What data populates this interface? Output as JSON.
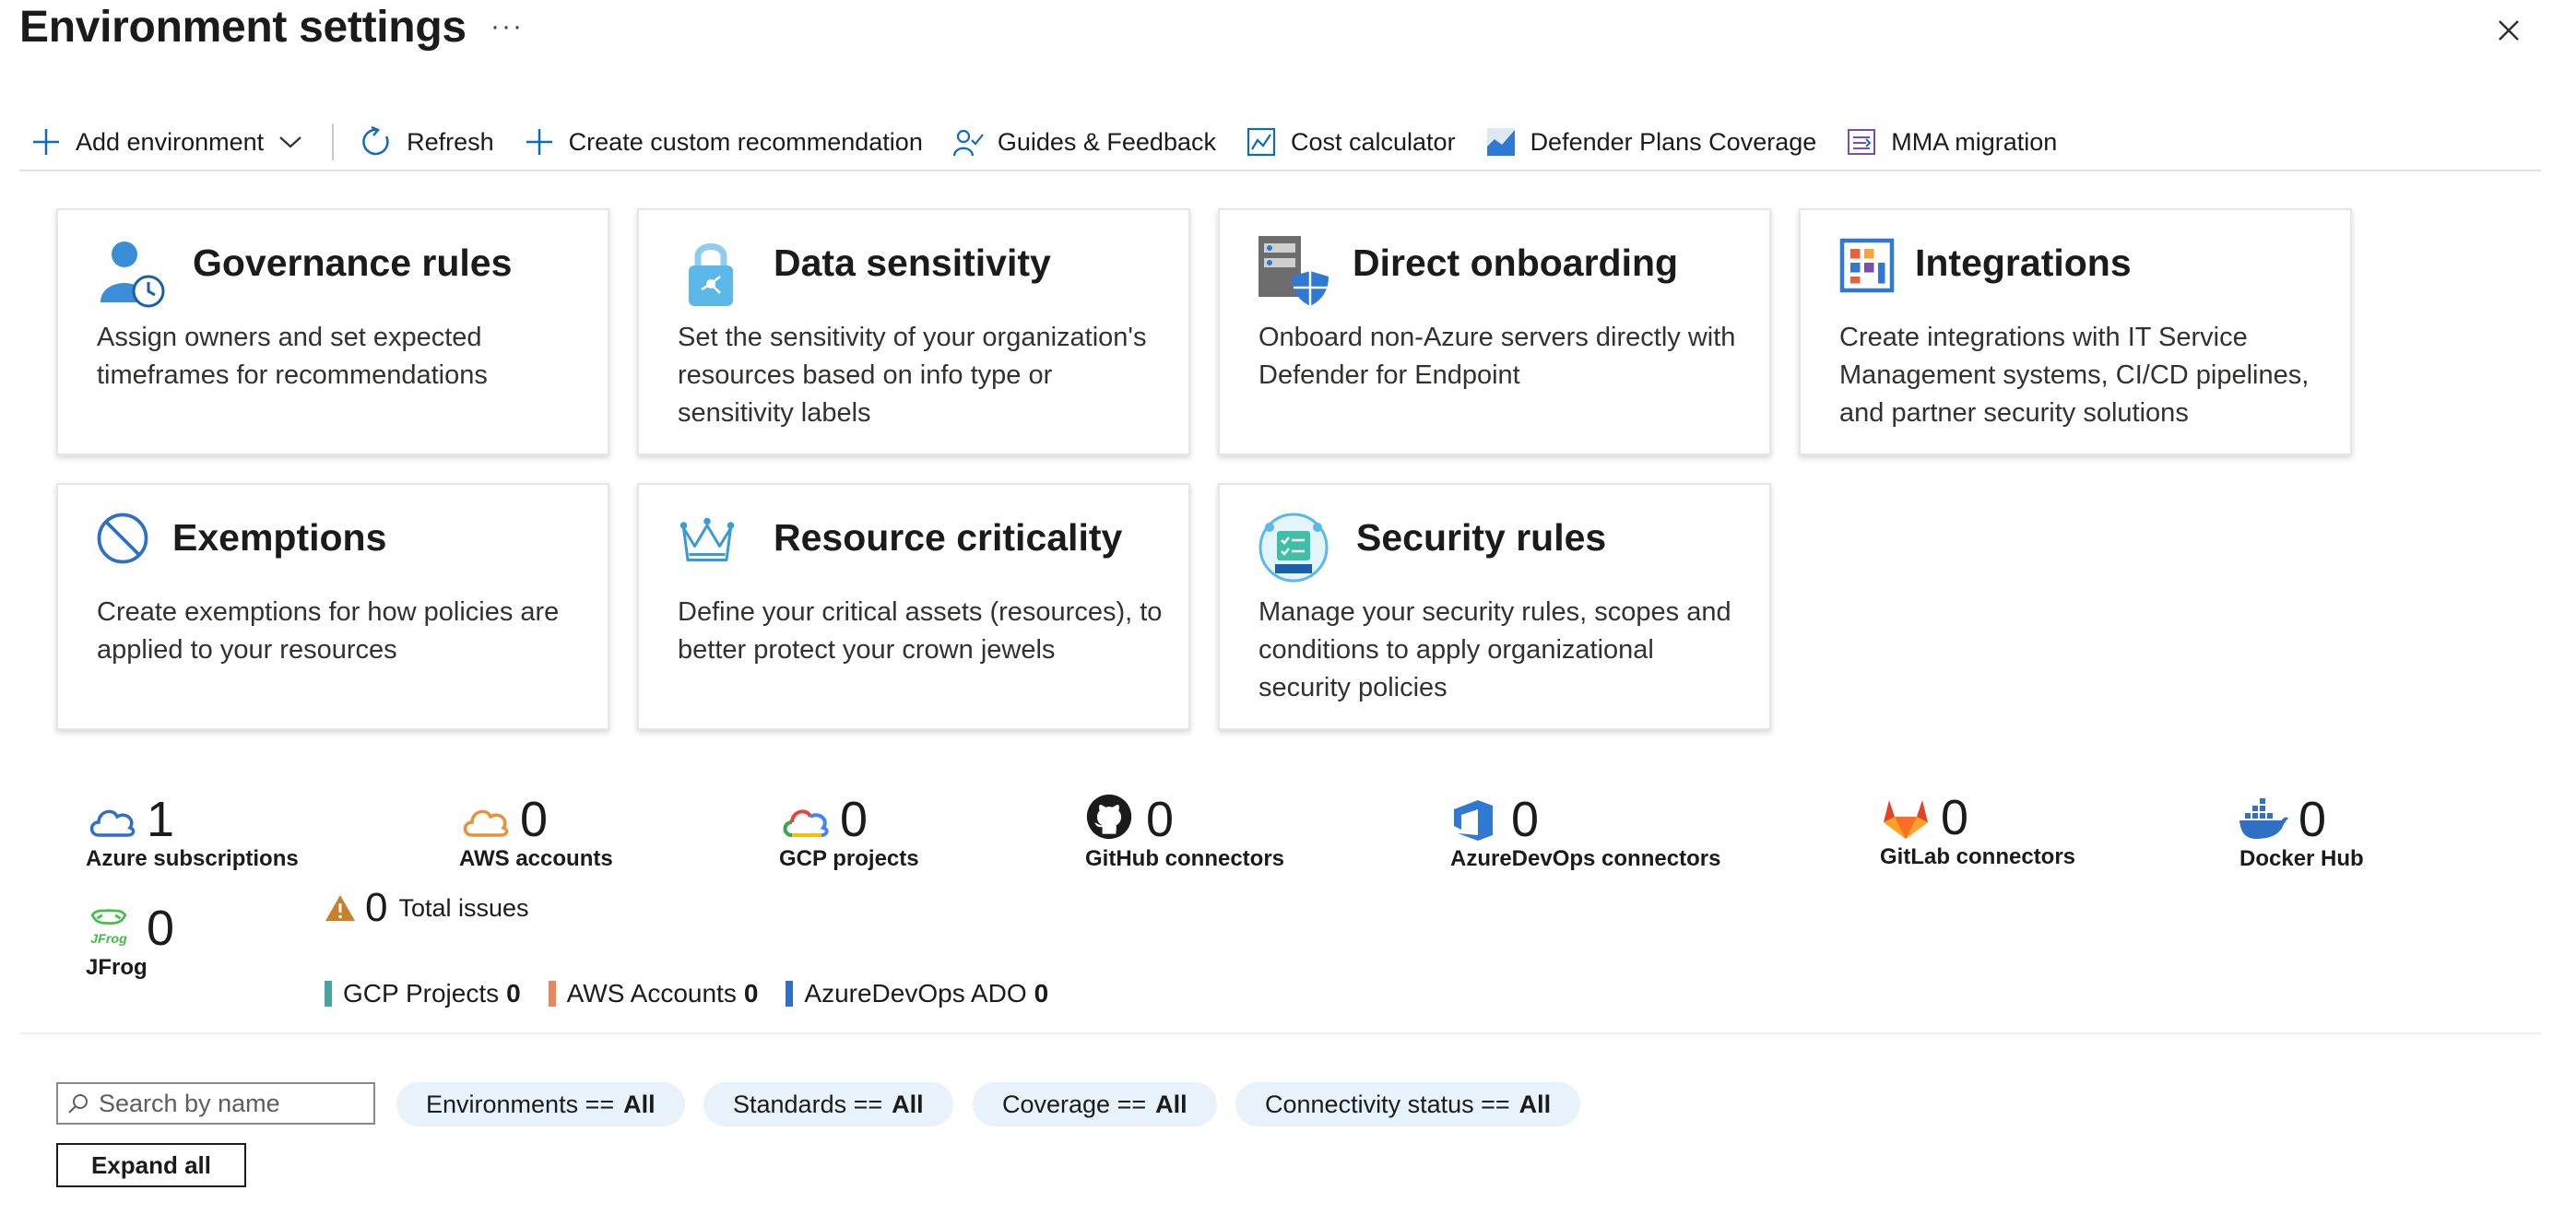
{
  "header": {
    "title": "Environment settings",
    "more": "···"
  },
  "toolbar": {
    "add_environment": "Add environment",
    "refresh": "Refresh",
    "create_custom_recommendation": "Create custom recommendation",
    "guides_feedback": "Guides & Feedback",
    "cost_calculator": "Cost calculator",
    "defender_plans_coverage": "Defender Plans Coverage",
    "mma_migration": "MMA migration"
  },
  "cards": [
    {
      "title": "Governance rules",
      "desc": "Assign owners and set expected timeframes for recommendations",
      "icon": "governance-icon"
    },
    {
      "title": "Data sensitivity",
      "desc": "Set the sensitivity of your organization's resources based on info type or sensitivity labels",
      "icon": "lock-icon"
    },
    {
      "title": "Direct onboarding",
      "desc": "Onboard non-Azure servers directly with Defender for Endpoint",
      "icon": "server-shield-icon"
    },
    {
      "title": "Integrations",
      "desc": "Create integrations with IT Service Management systems, CI/CD pipelines, and partner security solutions",
      "icon": "integrations-icon"
    },
    {
      "title": "Exemptions",
      "desc": "Create exemptions for how policies are applied to your resources",
      "icon": "no-entry-icon"
    },
    {
      "title": "Resource criticality",
      "desc": "Define your critical assets (resources), to better protect your crown jewels",
      "icon": "crown-icon"
    },
    {
      "title": "Security rules",
      "desc": "Manage your security rules, scopes and conditions to apply organizational security policies",
      "icon": "security-rules-icon"
    }
  ],
  "stats": [
    {
      "count": "1",
      "label": "Azure subscriptions",
      "icon": "azure-cloud-icon"
    },
    {
      "count": "0",
      "label": "AWS accounts",
      "icon": "aws-cloud-icon"
    },
    {
      "count": "0",
      "label": "GCP projects",
      "icon": "gcp-cloud-icon"
    },
    {
      "count": "0",
      "label": "GitHub connectors",
      "icon": "github-icon"
    },
    {
      "count": "0",
      "label": "AzureDevOps connectors",
      "icon": "azure-devops-icon"
    },
    {
      "count": "0",
      "label": "GitLab connectors",
      "icon": "gitlab-icon"
    },
    {
      "count": "0",
      "label": "Docker Hub",
      "icon": "docker-icon"
    },
    {
      "count": "0",
      "label": "JFrog",
      "icon": "jfrog-icon"
    }
  ],
  "issues": {
    "count": "0",
    "label": "Total issues"
  },
  "legend": [
    {
      "label": "GCP Projects",
      "count": "0",
      "color": "#4aa3a3"
    },
    {
      "label": "AWS Accounts",
      "count": "0",
      "color": "#e8885a"
    },
    {
      "label": "AzureDevOps ADO",
      "count": "0",
      "color": "#2f6fc4"
    }
  ],
  "filters": {
    "search_placeholder": "Search by name",
    "pills": [
      {
        "key": "Environments ==",
        "value": "All"
      },
      {
        "key": "Standards ==",
        "value": "All"
      },
      {
        "key": "Coverage ==",
        "value": "All"
      },
      {
        "key": "Connectivity status ==",
        "value": "All"
      }
    ],
    "expand_all": "Expand all"
  }
}
